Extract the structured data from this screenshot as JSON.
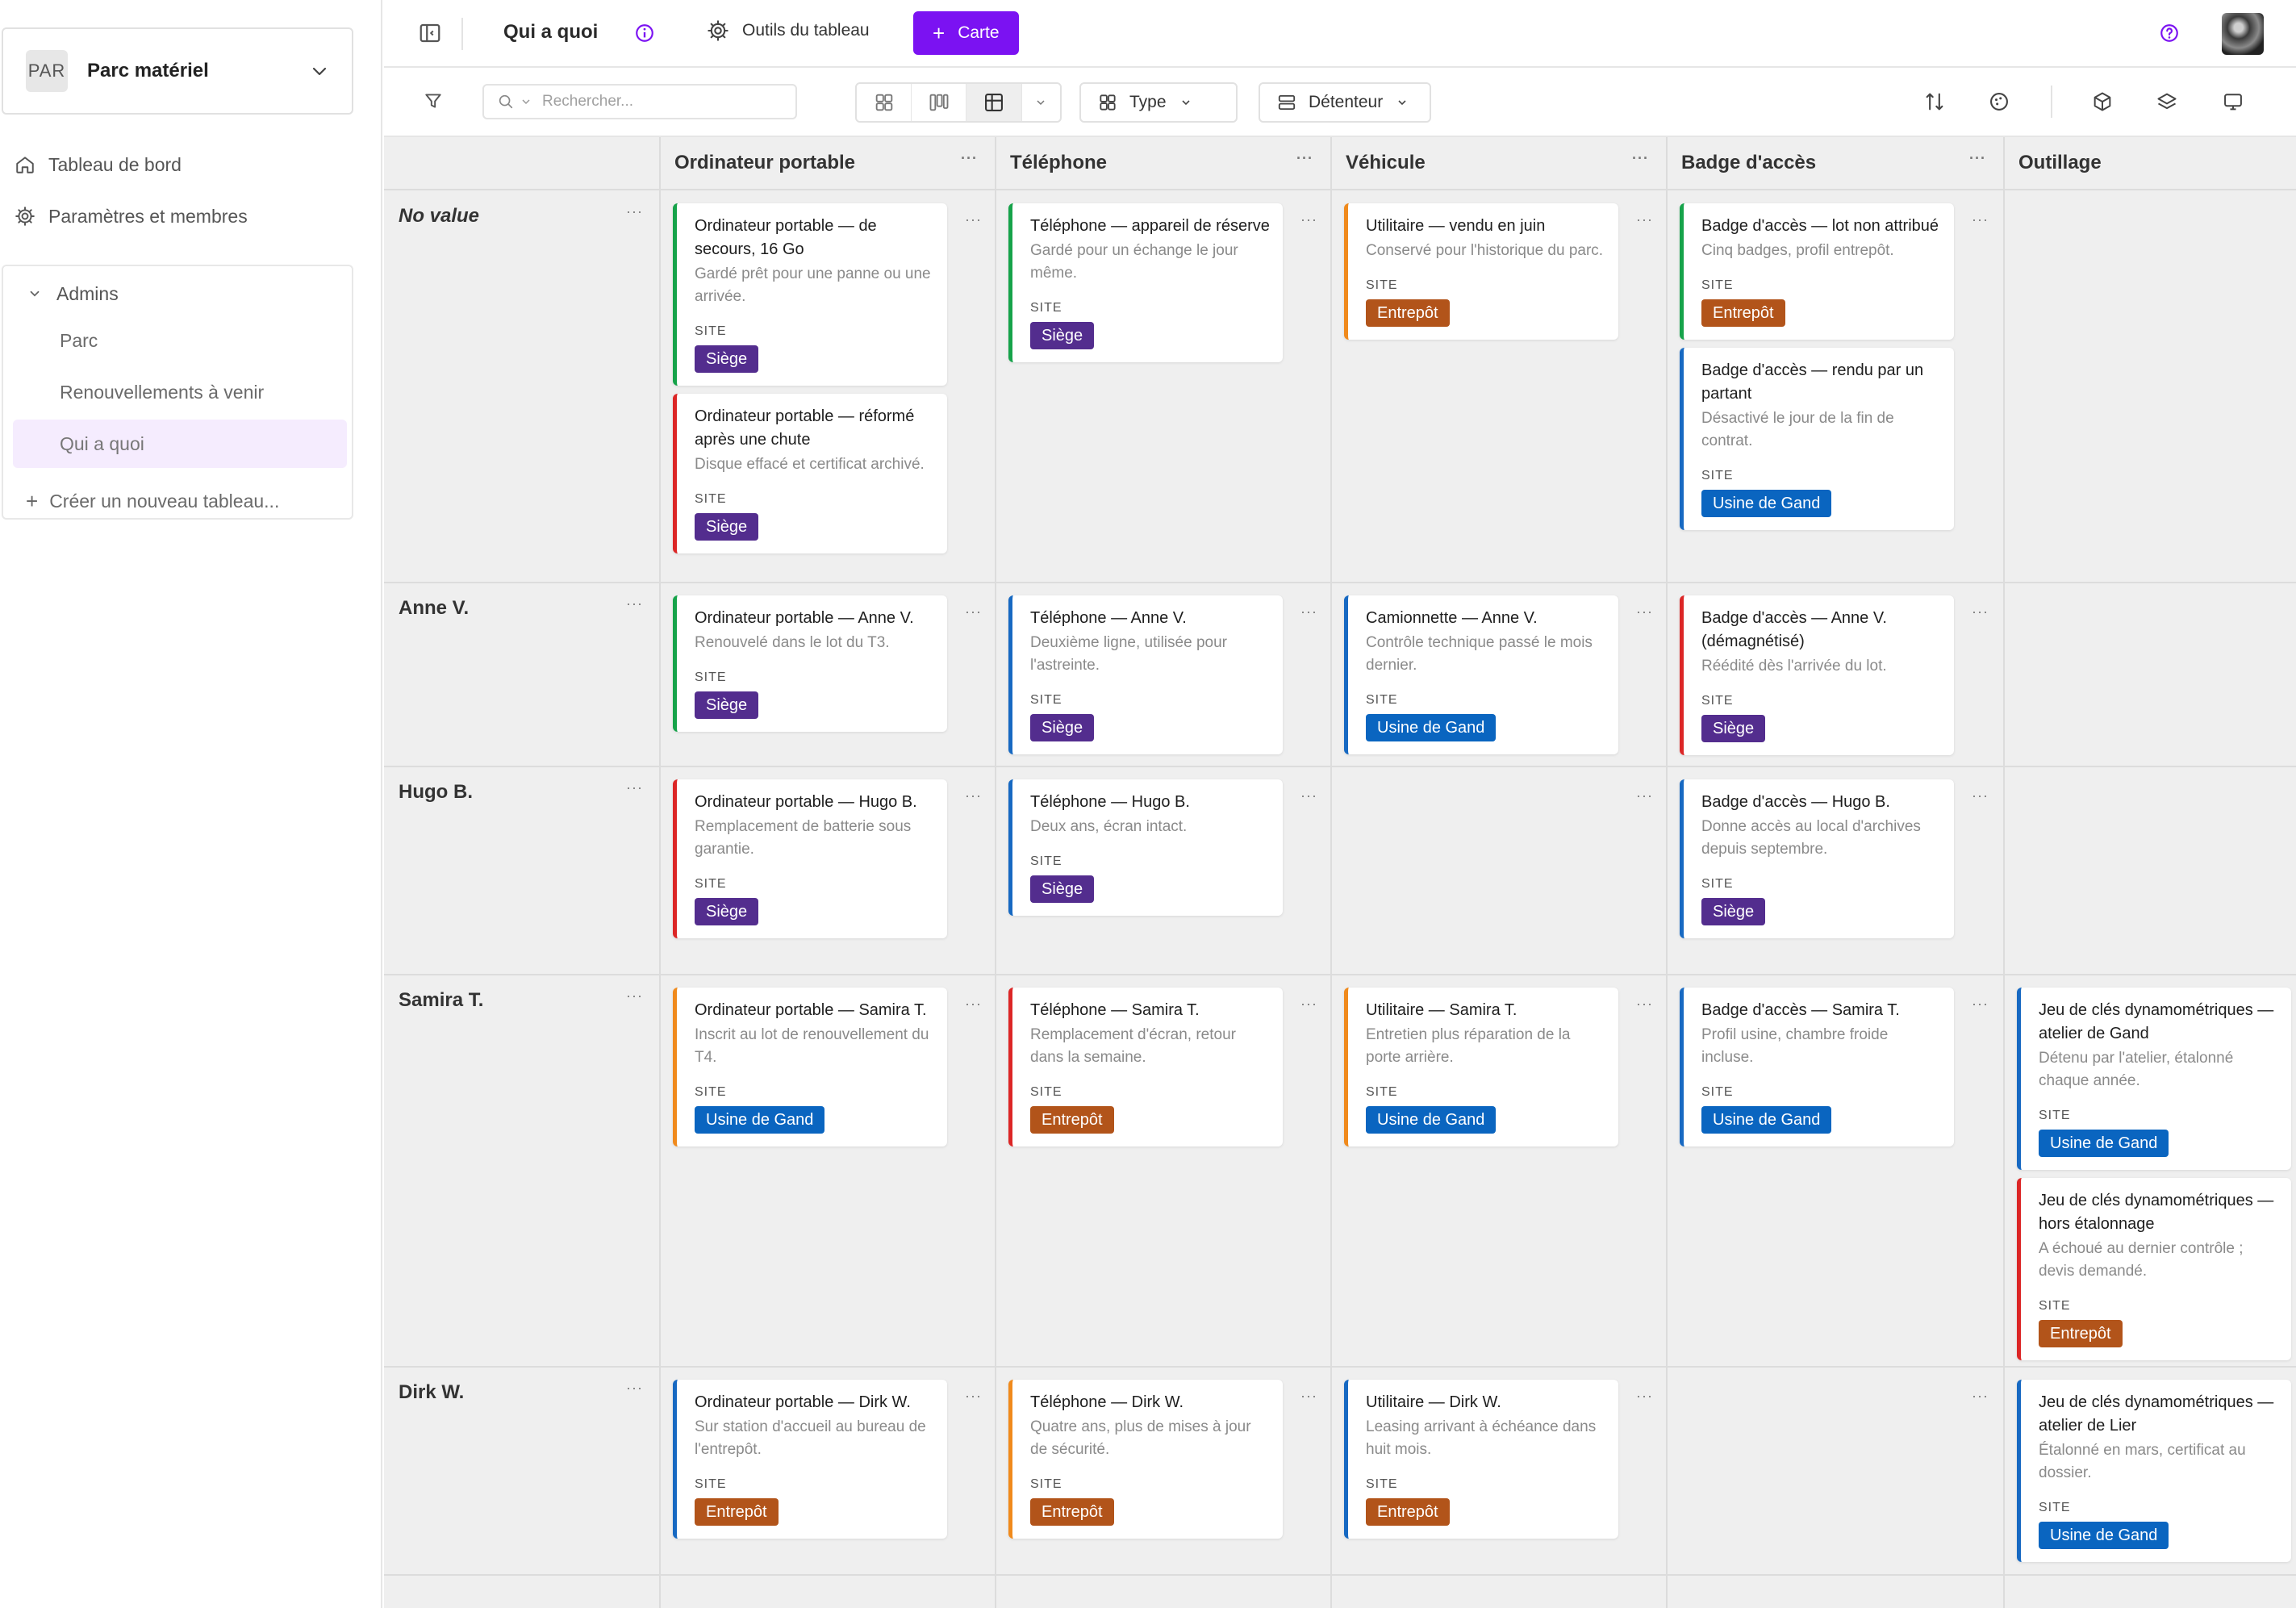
{
  "sidebar": {
    "workspace": {
      "avatar": "PAR",
      "name": "Parc matériel"
    },
    "nav": [
      {
        "label": "Tableau de bord",
        "icon": "home-icon"
      },
      {
        "label": "Paramètres et membres",
        "icon": "gear-icon"
      }
    ],
    "group": {
      "label": "Admins",
      "items": [
        {
          "label": "Parc",
          "active": false
        },
        {
          "label": "Renouvellements à venir",
          "active": false
        },
        {
          "label": "Qui a quoi",
          "active": true
        }
      ],
      "create_label": "Créer un nouveau tableau..."
    }
  },
  "topbar": {
    "board_title": "Qui a quoi",
    "tools_label": "Outils du tableau",
    "add_card_label": "Carte"
  },
  "toolbar": {
    "search_placeholder": "Rechercher...",
    "group_by": "Type",
    "sub_group_by": "Détenteur"
  },
  "colors": {
    "accent": "#7b12f2",
    "sites": {
      "Siège": "#532d8e",
      "Entrepôt": "#b2541a",
      "Usine de Gand": "#0a65c0"
    },
    "stripes": {
      "green": "#16a34a",
      "red": "#dc2626",
      "orange": "#f08a1c",
      "blue": "#1769c2"
    }
  },
  "board": {
    "field_label": "SITE",
    "columns": [
      "Ordinateur portable",
      "Téléphone",
      "Véhicule",
      "Badge d'accès",
      "Outillage"
    ],
    "rows": [
      {
        "label": "No value",
        "cells": [
          [
            {
              "title": "Ordinateur portable — de secours, 16 Go",
              "desc": "Gardé prêt pour une panne ou une arrivée.",
              "site": "Siège",
              "stripe": "green"
            },
            {
              "title": "Ordinateur portable — réformé après une chute",
              "desc": "Disque effacé et certificat archivé.",
              "site": "Siège",
              "stripe": "red"
            }
          ],
          [
            {
              "title": "Téléphone — appareil de réserve",
              "desc": "Gardé pour un échange le jour même.",
              "site": "Siège",
              "stripe": "green"
            }
          ],
          [
            {
              "title": "Utilitaire — vendu en juin",
              "desc": "Conservé pour l'historique du parc.",
              "site": "Entrepôt",
              "stripe": "orange"
            }
          ],
          [
            {
              "title": "Badge d'accès — lot non attribué",
              "desc": "Cinq badges, profil entrepôt.",
              "site": "Entrepôt",
              "stripe": "green"
            },
            {
              "title": "Badge d'accès — rendu par un partant",
              "desc": "Désactivé le jour de la fin de contrat.",
              "site": "Usine de Gand",
              "stripe": "blue"
            }
          ],
          []
        ]
      },
      {
        "label": "Anne V.",
        "cells": [
          [
            {
              "title": "Ordinateur portable — Anne V.",
              "desc": "Renouvelé dans le lot du T3.",
              "site": "Siège",
              "stripe": "green"
            }
          ],
          [
            {
              "title": "Téléphone — Anne V.",
              "desc": "Deuxième ligne, utilisée pour l'astreinte.",
              "site": "Siège",
              "stripe": "blue"
            }
          ],
          [
            {
              "title": "Camionnette — Anne V.",
              "desc": "Contrôle technique passé le mois dernier.",
              "site": "Usine de Gand",
              "stripe": "blue"
            }
          ],
          [
            {
              "title": "Badge d'accès — Anne V. (démagnétisé)",
              "desc": "Réédité dès l'arrivée du lot.",
              "site": "Siège",
              "stripe": "red"
            }
          ],
          []
        ]
      },
      {
        "label": "Hugo B.",
        "cells": [
          [
            {
              "title": "Ordinateur portable — Hugo B.",
              "desc": "Remplacement de batterie sous garantie.",
              "site": "Siège",
              "stripe": "red"
            }
          ],
          [
            {
              "title": "Téléphone — Hugo B.",
              "desc": "Deux ans, écran intact.",
              "site": "Siège",
              "stripe": "blue"
            }
          ],
          [],
          [
            {
              "title": "Badge d'accès — Hugo B.",
              "desc": "Donne accès au local d'archives depuis septembre.",
              "site": "Siège",
              "stripe": "blue"
            }
          ],
          []
        ]
      },
      {
        "label": "Samira T.",
        "cells": [
          [
            {
              "title": "Ordinateur portable — Samira T.",
              "desc": "Inscrit au lot de renouvellement du T4.",
              "site": "Usine de Gand",
              "stripe": "orange"
            }
          ],
          [
            {
              "title": "Téléphone — Samira T.",
              "desc": "Remplacement d'écran, retour dans la semaine.",
              "site": "Entrepôt",
              "stripe": "red"
            }
          ],
          [
            {
              "title": "Utilitaire — Samira T.",
              "desc": "Entretien plus réparation de la porte arrière.",
              "site": "Usine de Gand",
              "stripe": "orange"
            }
          ],
          [
            {
              "title": "Badge d'accès — Samira T.",
              "desc": "Profil usine, chambre froide incluse.",
              "site": "Usine de Gand",
              "stripe": "blue"
            }
          ],
          [
            {
              "title": "Jeu de clés dynamométriques — atelier de Gand",
              "desc": "Détenu par l'atelier, étalonné chaque année.",
              "site": "Usine de Gand",
              "stripe": "blue"
            },
            {
              "title": "Jeu de clés dynamométriques — hors étalonnage",
              "desc": "A échoué au dernier contrôle ; devis demandé.",
              "site": "Entrepôt",
              "stripe": "red"
            }
          ]
        ]
      },
      {
        "label": "Dirk W.",
        "cells": [
          [
            {
              "title": "Ordinateur portable — Dirk W.",
              "desc": "Sur station d'accueil au bureau de l'entrepôt.",
              "site": "Entrepôt",
              "stripe": "blue"
            }
          ],
          [
            {
              "title": "Téléphone — Dirk W.",
              "desc": "Quatre ans, plus de mises à jour de sécurité.",
              "site": "Entrepôt",
              "stripe": "orange"
            }
          ],
          [
            {
              "title": "Utilitaire — Dirk W.",
              "desc": "Leasing arrivant à échéance dans huit mois.",
              "site": "Entrepôt",
              "stripe": "blue"
            }
          ],
          [],
          [
            {
              "title": "Jeu de clés dynamométriques — atelier de Lier",
              "desc": "Étalonné en mars, certificat au dossier.",
              "site": "Usine de Gand",
              "stripe": "blue"
            }
          ]
        ]
      }
    ]
  }
}
